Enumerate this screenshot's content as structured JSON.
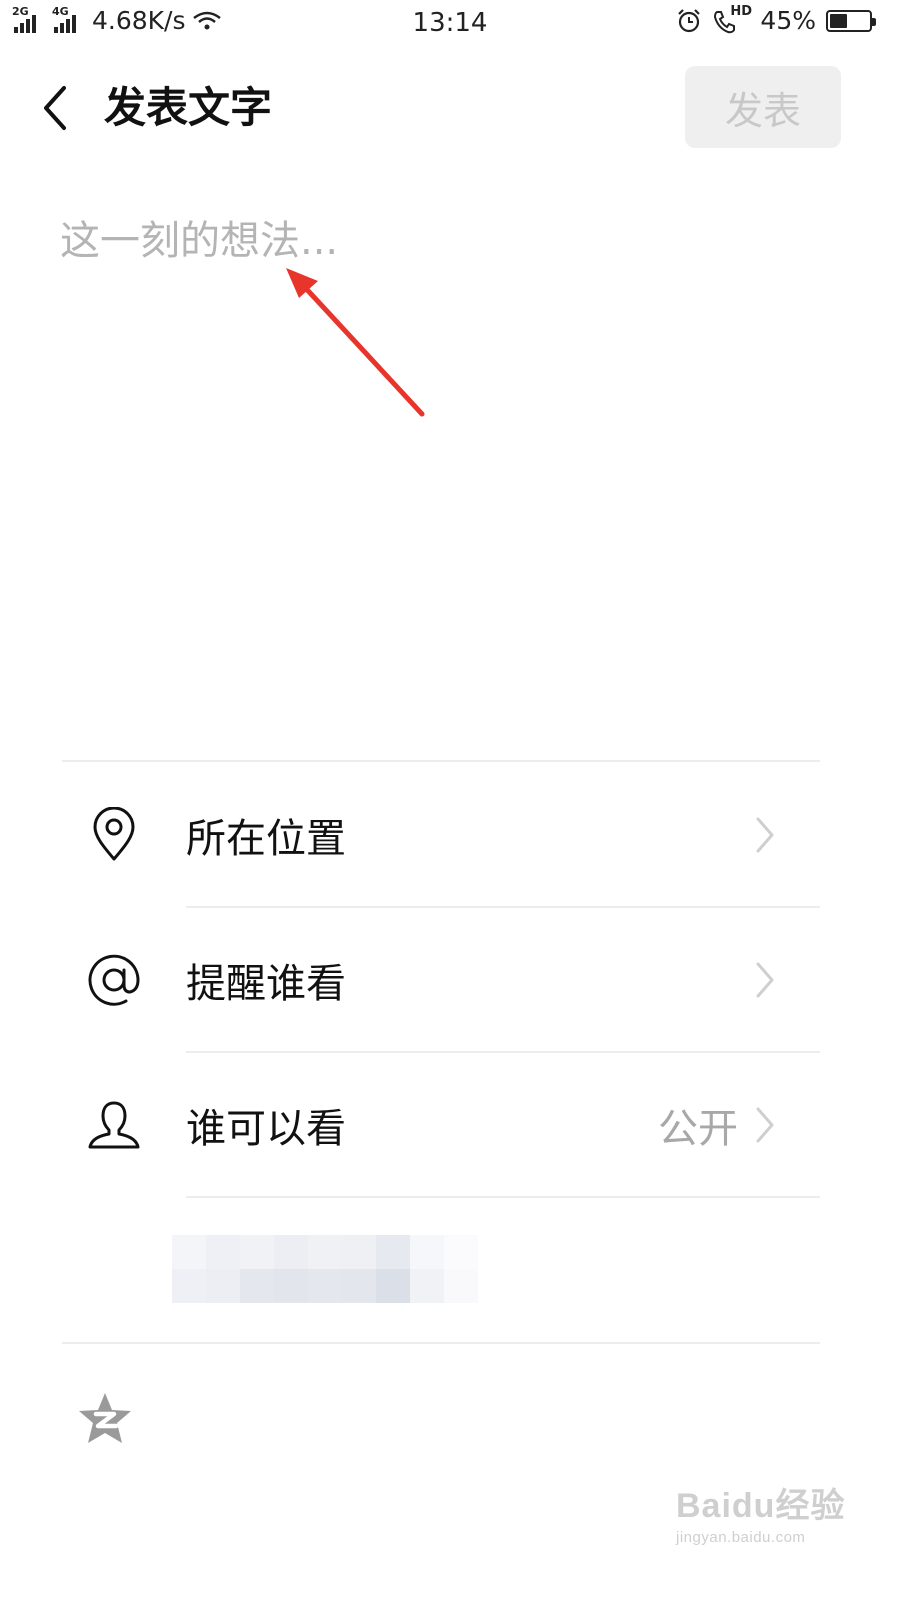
{
  "status_bar": {
    "sim1_tag": "2G",
    "sim2_tag": "4G",
    "net_speed": "4.68K/s",
    "time": "13:14",
    "hd_tag": "HD",
    "battery_percent": "45%",
    "battery_level": 0.45
  },
  "header": {
    "title": "发表文字",
    "publish_label": "发表"
  },
  "editor": {
    "placeholder": "这一刻的想法..."
  },
  "options": [
    {
      "label": "所在位置",
      "value": "",
      "icon": "location-pin-icon"
    },
    {
      "label": "提醒谁看",
      "value": "",
      "icon": "at-sign-icon"
    },
    {
      "label": "谁可以看",
      "value": "公开",
      "icon": "person-icon"
    }
  ],
  "bottom": {
    "icon": "qzone-star-icon"
  },
  "watermark": {
    "line1": "Baidu经验",
    "line2": "jingyan.baidu.com"
  },
  "colors": {
    "annotation_arrow": "#e8352c",
    "publish_button_bg": "#efefef",
    "publish_button_text": "#c8c8c8",
    "divider": "#ededed",
    "secondary_text": "#a8a8a8"
  }
}
